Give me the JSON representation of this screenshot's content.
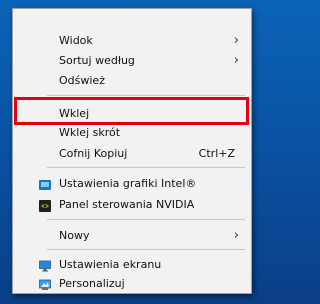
{
  "menu": {
    "items": [
      {
        "label": "Widok",
        "has_submenu": true
      },
      {
        "label": "Sortuj według",
        "has_submenu": true
      },
      {
        "label": "Odśwież"
      },
      {
        "label": "Wklej"
      },
      {
        "label": "Wklej skrót"
      },
      {
        "label": "Cofnij Kopiuj",
        "shortcut": "Ctrl+Z"
      },
      {
        "label": "Ustawienia grafiki Intel®",
        "icon": "intel-graphics-icon"
      },
      {
        "label": "Panel sterowania NVIDIA",
        "icon": "nvidia-icon"
      },
      {
        "label": "Nowy",
        "has_submenu": true
      },
      {
        "label": "Ustawienia ekranu",
        "icon": "display-settings-icon"
      },
      {
        "label": "Personalizuj",
        "icon": "personalize-icon"
      }
    ],
    "highlighted_item": "Wklej",
    "highlight_color": "#e4000f"
  },
  "colors": {
    "menu_background": "#f2f2f2",
    "desktop_background": "#0a4fa0",
    "highlight_border": "#e4000f"
  }
}
